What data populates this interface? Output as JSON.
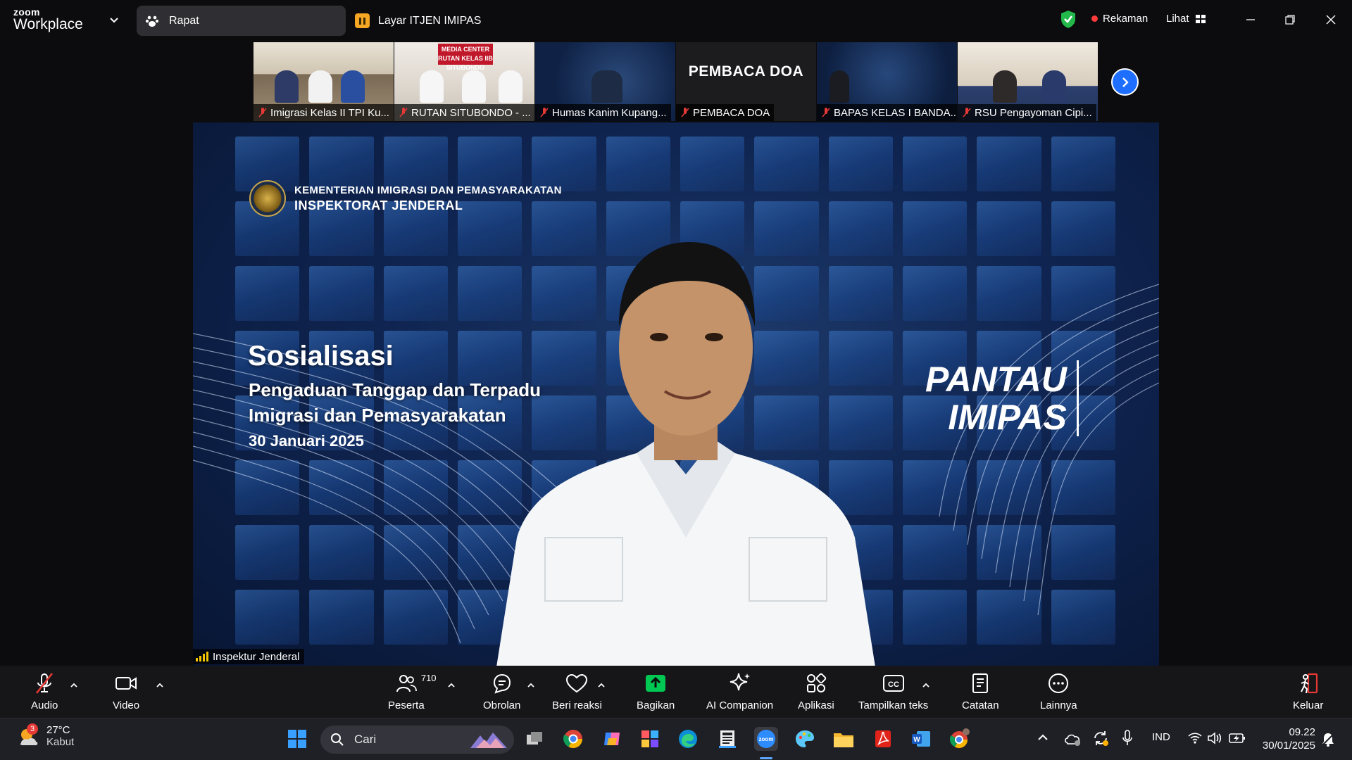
{
  "app": {
    "brand_top": "zoom",
    "brand_bottom": "Workplace",
    "tab_meeting": "Rapat",
    "tab_share": "Layar ITJEN IMIPAS",
    "recording_label": "Rekaman",
    "view_label": "Lihat"
  },
  "thumbnails": [
    {
      "label": "Imigrasi Kelas II TPI Ku..."
    },
    {
      "label": "RUTAN SITUBONDO - ...",
      "sign": "MEDIA CENTER RUTAN KELAS IIB SITUBONDO"
    },
    {
      "label": "Humas Kanim Kupang..."
    },
    {
      "label": "PEMBACA DOA",
      "center_text": "PEMBACA DOA"
    },
    {
      "label": "BAPAS KELAS I BANDA..."
    },
    {
      "label": "RSU Pengayoman Cipi..."
    }
  ],
  "main_video": {
    "org_line1": "KEMENTERIAN IMIGRASI DAN PEMASYARAKATAN",
    "org_line2": "INSPEKTORAT JENDERAL",
    "title": "Sosialisasi",
    "subtitle_line1": "Pengaduan Tanggap dan Terpadu",
    "subtitle_line2": "Imigrasi dan Pemasyarakatan",
    "date": "30 Januari 2025",
    "brand_line1": "PANTAU",
    "brand_line2": "IMIPAS",
    "speaker_name": "Inspektur Jenderal"
  },
  "toolbar": {
    "audio": "Audio",
    "video": "Video",
    "participants": "Peserta",
    "participants_count": "710",
    "chat": "Obrolan",
    "react": "Beri reaksi",
    "share": "Bagikan",
    "ai": "AI Companion",
    "apps": "Aplikasi",
    "captions": "Tampilkan teks",
    "notes": "Catatan",
    "more": "Lainnya",
    "leave": "Keluar"
  },
  "taskbar": {
    "weather_badge": "3",
    "temperature": "27°C",
    "condition": "Kabut",
    "search_placeholder": "Cari",
    "language": "IND",
    "time": "09.22",
    "date": "30/01/2025"
  },
  "colors": {
    "accent": "#1e6fff",
    "record": "#ff3b3b",
    "share_green": "#00c853",
    "share_tab": "#f5a623"
  }
}
